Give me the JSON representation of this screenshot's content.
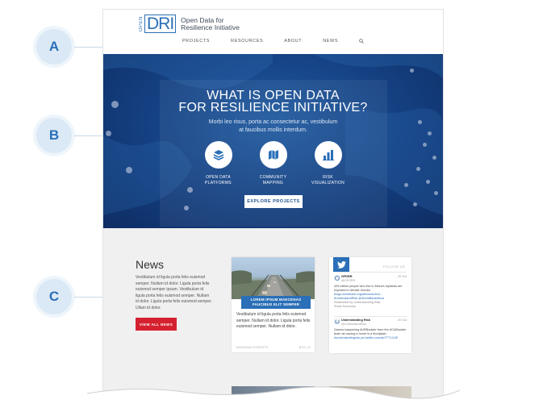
{
  "callouts": [
    "A",
    "B",
    "C"
  ],
  "logo": {
    "open": "OPEN",
    "dri": "DRI",
    "line1": "Open Data for",
    "line2": "Resilience Initiative"
  },
  "nav": {
    "items": [
      "PROJECTS",
      "RESOURCES",
      "ABOUT",
      "NEWS"
    ],
    "search_icon": "search-icon"
  },
  "hero": {
    "title_line1": "WHAT IS OPEN DATA",
    "title_line2": "FOR RESILIENCE INITIATIVE?",
    "subtitle_line1": "Morbi leo risus, porta ac consectetur ac, vestibulum",
    "subtitle_line2": "at faucibus mollis interdum.",
    "features": [
      {
        "icon": "layers-icon",
        "line1": "OPEN DATA",
        "line2": "PLATFORMS"
      },
      {
        "icon": "map-icon",
        "line1": "COMMUNITY",
        "line2": "MAPPING"
      },
      {
        "icon": "bar-chart-icon",
        "line1": "RISK",
        "line2": "VISUALIZATION"
      }
    ],
    "cta": "EXPLORE PROJECTS"
  },
  "news": {
    "title": "News",
    "body": "Vestibulum id ligula porta felis euismod semper. Nullam id dolor. Ligula porta felis euismod semper ipsum. Vestibulum id ligula porta felis euismod semper. Nullam id dolor. Ligula porta felis euismod semper. Ullam id dolor.",
    "button": "VIEW ALL NEWS"
  },
  "card": {
    "banner_line1": "LOREM IPSUM MAECENAS",
    "banner_line2": "FAUCIBUS ELIT SEMPER",
    "body": "Vestibulum id ligula porta felis euismod semper. Nullam id dolor. Ligula porta felis euismod semper. Nullam id dolor.",
    "author": "MAKENNA ROBERTS",
    "date": "NOV 10"
  },
  "twitter": {
    "follow": "FOLLOW US",
    "tweets": [
      {
        "name": "GFDRR",
        "handle": "@GFDRR",
        "date": "20 Oct",
        "text": "425 million people who live in Africa's drylands are exposed to climate shocks:",
        "link": "blogs.worldbank.org/africacan/but... #UnderstandRisk @WorldBankAfrica",
        "meta1": "Retweeted by Understanding Risk",
        "meta2": "Show Summary"
      },
      {
        "name": "Understanding Risk",
        "handle": "@UnderstandRisk",
        "date": "20 Oct",
        "text": "Games happening #URBoulder from the #CUBoulder team all owning a home in a floodplain",
        "link": "#understandingrisk pic.twitter.com/ab7TTJJJJE",
        "meta1": "",
        "meta2": ""
      }
    ]
  },
  "colors": {
    "brand_blue": "#2a6fb7",
    "hero_blue": "#143f80",
    "news_red": "#d5212f",
    "section_gray": "#f0f0f0"
  }
}
